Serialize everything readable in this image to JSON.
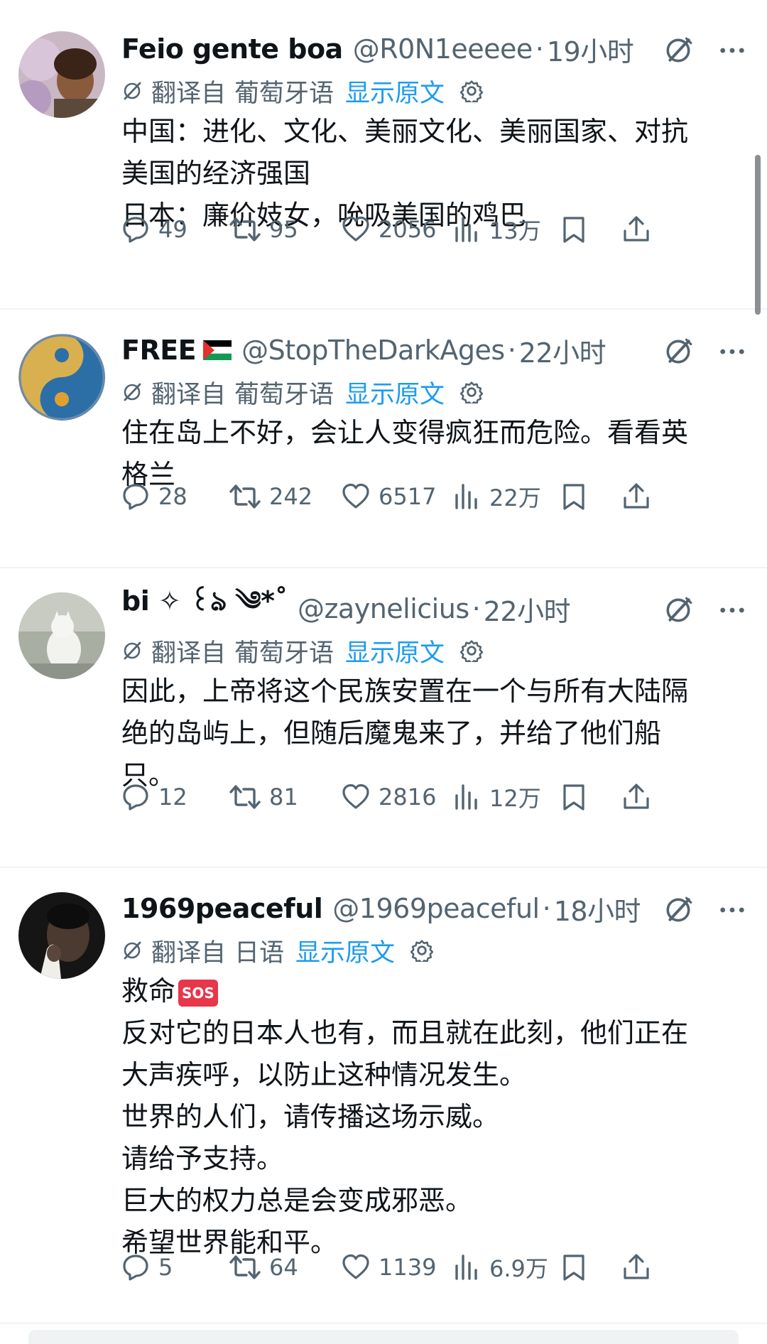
{
  "translate": {
    "prefix": "翻译自",
    "show_original": "显示原文"
  },
  "tweets": [
    {
      "name": "Feio gente boa",
      "handle": "@R0N1eeeee",
      "dot": "·",
      "time": "19小时",
      "lang": "葡萄牙语",
      "lines": [
        "中国：进化、文化、美丽文化、美丽国家、对抗",
        "美国的经济强国",
        "日本：廉价妓女，吮吸美国的鸡巴"
      ],
      "replies": "49",
      "retweets": "95",
      "likes": "2056",
      "views": "13万"
    },
    {
      "name": "FREE",
      "flag_icon": "palestine-flag-icon",
      "handle": "@StopTheDarkAges",
      "dot": "·",
      "time": "22小时",
      "lang": "葡萄牙语",
      "lines": [
        "住在岛上不好，会让人变得疯狂而危险。看看英",
        "格兰"
      ],
      "replies": "28",
      "retweets": "242",
      "likes": "6517",
      "views": "22万"
    },
    {
      "name": "bi ✧ ꒰ঌ ༄*˚",
      "handle": "@zaynelicius",
      "dot": "·",
      "time": "22小时",
      "lang": "葡萄牙语",
      "lines": [
        "因此，上帝将这个民族安置在一个与所有大陆隔",
        "绝的岛屿上，但随后魔鬼来了，并给了他们船",
        "只。"
      ],
      "replies": "12",
      "retweets": "81",
      "likes": "2816",
      "views": "12万"
    },
    {
      "name": "1969peaceful",
      "handle": "@1969peaceful",
      "dot": "·",
      "time": "18小时",
      "lang": "日语",
      "first_line": "救命",
      "sos": "SOS",
      "lines": [
        "反对它的日本人也有，而且就在此刻，他们正在",
        "大声疾呼，以防止这种情况发生。",
        "世界的人们，请传播这场示威。",
        "请给予支持。",
        "巨大的权力总是会变成邪恶。",
        "希望世界能和平。"
      ],
      "replies": "5",
      "retweets": "64",
      "likes": "1139",
      "views": "6.9万"
    }
  ],
  "colors": {
    "text": "#0f1419",
    "secondary": "#536471",
    "link": "#1d9bf0",
    "divider": "#eff3f4",
    "sos": "#e8364a"
  }
}
